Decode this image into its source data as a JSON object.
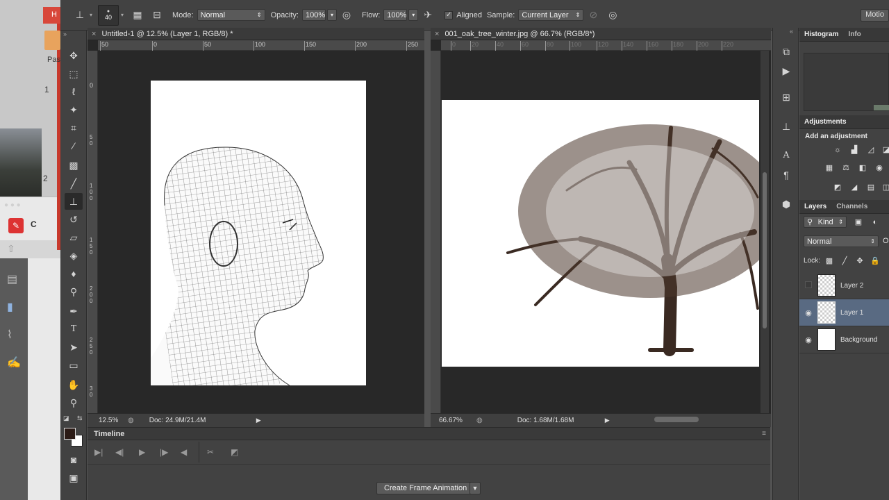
{
  "background_app": {
    "tab_text": "H",
    "items": [
      "Pas",
      "1",
      "2",
      "C"
    ]
  },
  "options_bar": {
    "brush_size": "40",
    "mode_label": "Mode:",
    "mode_value": "Normal",
    "opacity_label": "Opacity:",
    "opacity_value": "100%",
    "flow_label": "Flow:",
    "flow_value": "100%",
    "aligned_label": "Aligned",
    "sample_label": "Sample:",
    "sample_value": "Current Layer",
    "motion_label": "Motio"
  },
  "doc1": {
    "tab_title": "Untitled-1 @ 12.5% (Layer 1, RGB/8) *",
    "ruler_h": [
      "50",
      "0",
      "50",
      "100",
      "150",
      "200",
      "250"
    ],
    "ruler_v": [
      "0",
      "5 0",
      "1 0 0",
      "1 5 0",
      "2 0 0",
      "2 5 0",
      "3 0"
    ],
    "zoom": "12.5%",
    "doc_size": "Doc: 24.9M/21.4M"
  },
  "doc2": {
    "tab_title": "001_oak_tree_winter.jpg @ 66.7% (RGB/8*)",
    "ruler_h": [
      "0",
      "20",
      "40",
      "60",
      "80",
      "100",
      "120",
      "140",
      "160",
      "180",
      "200",
      "220"
    ],
    "zoom": "66.67%",
    "doc_size": "Doc: 1.68M/1.68M"
  },
  "timeline": {
    "title": "Timeline",
    "create_button": "Create Frame Animation"
  },
  "panels": {
    "histogram_tab": "Histogram",
    "info_tab": "Info",
    "adjustments_tab": "Adjustments",
    "add_adjustment": "Add an adjustment",
    "layers_tab": "Layers",
    "channels_tab": "Channels",
    "kind_filter": "Kind",
    "blend_mode": "Normal",
    "opacity_short": "O",
    "lock_label": "Lock:",
    "layers": [
      {
        "name": "Layer 2",
        "visible": false
      },
      {
        "name": "Layer 1",
        "visible": true
      },
      {
        "name": "Background",
        "visible": true
      }
    ]
  },
  "colors": {
    "accent_selected": "#596a82",
    "panel": "#424242",
    "canvas_bg": "#282828"
  }
}
